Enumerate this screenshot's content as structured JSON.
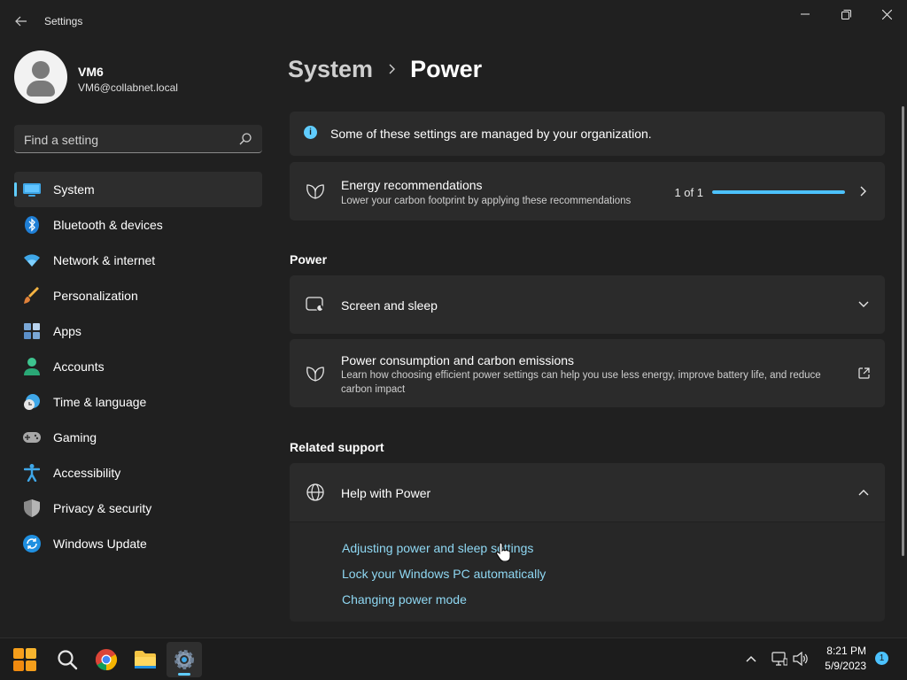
{
  "window": {
    "title": "Settings"
  },
  "profile": {
    "name": "VM6",
    "email": "VM6@collabnet.local"
  },
  "search": {
    "placeholder": "Find a setting"
  },
  "sidebar": {
    "items": [
      {
        "label": "System",
        "icon": "system-icon",
        "active": true
      },
      {
        "label": "Bluetooth & devices",
        "icon": "bluetooth-icon"
      },
      {
        "label": "Network & internet",
        "icon": "wifi-icon"
      },
      {
        "label": "Personalization",
        "icon": "brush-icon"
      },
      {
        "label": "Apps",
        "icon": "apps-icon"
      },
      {
        "label": "Accounts",
        "icon": "accounts-icon"
      },
      {
        "label": "Time & language",
        "icon": "clock-globe-icon"
      },
      {
        "label": "Gaming",
        "icon": "gamepad-icon"
      },
      {
        "label": "Accessibility",
        "icon": "accessibility-icon"
      },
      {
        "label": "Privacy & security",
        "icon": "shield-icon"
      },
      {
        "label": "Windows Update",
        "icon": "update-icon"
      }
    ]
  },
  "breadcrumb": {
    "parent": "System",
    "current": "Power"
  },
  "main": {
    "org_notice": "Some of these settings are managed by your organization.",
    "energy": {
      "title": "Energy recommendations",
      "desc": "Lower your carbon footprint by applying these recommendations",
      "count": "1 of 1",
      "progress": 1.0
    },
    "power_section": "Power",
    "screen_sleep": {
      "title": "Screen and sleep"
    },
    "consumption": {
      "title": "Power consumption and carbon emissions",
      "desc": "Learn how choosing efficient power settings can help you use less energy, improve battery life, and reduce carbon impact"
    },
    "related_section": "Related support",
    "help": {
      "title": "Help with Power",
      "links": [
        "Adjusting power and sleep settings",
        "Lock your Windows PC automatically",
        "Changing power mode"
      ]
    }
  },
  "taskbar": {
    "apps": [
      "start-icon",
      "search-icon",
      "chrome-icon",
      "file-explorer-icon",
      "settings-icon"
    ],
    "time": "8:21 PM",
    "date": "5/9/2023",
    "notifications": "1"
  },
  "colors": {
    "accent": "#60cdff",
    "link": "#8fd8f3",
    "background": "#202020",
    "card": "#2b2b2b"
  }
}
